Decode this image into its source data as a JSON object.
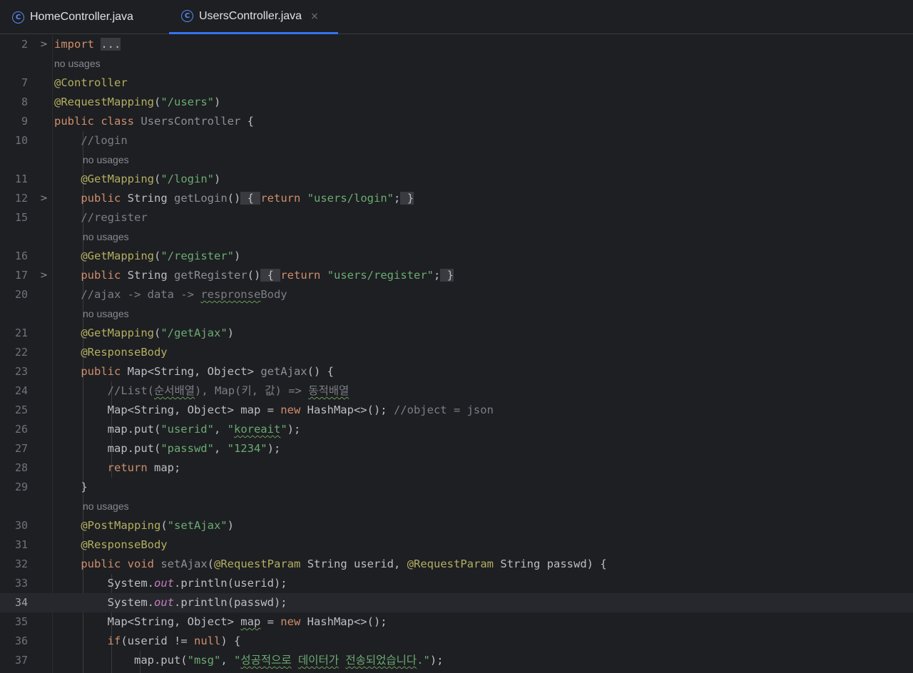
{
  "tabs": [
    {
      "label": "HomeController.java",
      "icon": "class-icon",
      "active": false
    },
    {
      "label": "UsersController.java",
      "icon": "class-icon",
      "active": true,
      "close": "×"
    }
  ],
  "hint_text": "no usages",
  "code": {
    "import_kw": "import",
    "import_folded": "...",
    "controller_ann": "@Controller",
    "reqmap_ann": "@RequestMapping",
    "reqmap_path": "\"/users\"",
    "class_public": "public",
    "class_kw": "class",
    "class_name": "UsersController",
    "c_login": "//login",
    "getmapping": "@GetMapping",
    "login_path": "\"/login\"",
    "public": "public",
    "String": "String",
    "getLogin": "getLogin",
    "return": "return",
    "users_login": "\"users/login\"",
    "c_register": "//register",
    "register_path": "\"/register\"",
    "getRegister": "getRegister",
    "users_register": "\"users/register\"",
    "c_ajax_a": "//ajax -> data -> ",
    "c_ajax_typo": "respronse",
    "c_ajax_b": "Body",
    "getajax_path": "\"/getAjax\"",
    "responsebody": "@ResponseBody",
    "map_decl": "Map<String, Object> ",
    "getAjax": "getAjax",
    "c_list_a": "//List(",
    "c_list_typo1": "순서배열",
    "c_list_b": "), Map(키, 값) => ",
    "c_list_typo2": "동적배열",
    "map_assign": "Map<String, Object> map = ",
    "new": "new",
    "hashmap": " HashMap<>(); ",
    "c_object": "//object = json",
    "map_put_open": "map.put(",
    "userid_key": "\"userid\"",
    "koreait_q": "\"",
    "koreait": "koreait",
    "passwd_key": "\"passwd\"",
    "pw_value": "\"1234\"",
    "return_map": " map;",
    "postmapping": "@PostMapping",
    "setajax_path": "\"setAjax\"",
    "void": "void",
    "setAjax": "setAjax",
    "requestparam": "@RequestParam",
    "system": "System.",
    "out": "out",
    "println_userid": ".println(userid);",
    "println_passwd": ".println(passwd);",
    "map_word": "map",
    "if_kw": "if",
    "if_cond": "(userid != ",
    "null": "null",
    "msg_key": "\"msg\"",
    "msg_a": "\"",
    "msg_ko1": "성공적으로",
    "msg_ko2": "데이터가",
    "msg_ko3": "전송되었습니다",
    "msg_b": ".\""
  },
  "line_numbers": [
    "2",
    "7",
    "8",
    "9",
    "10",
    "11",
    "12",
    "15",
    "16",
    "17",
    "20",
    "21",
    "22",
    "23",
    "24",
    "25",
    "26",
    "27",
    "28",
    "29",
    "30",
    "31",
    "32",
    "33",
    "34",
    "35",
    "36",
    "37"
  ],
  "current_line": "34"
}
